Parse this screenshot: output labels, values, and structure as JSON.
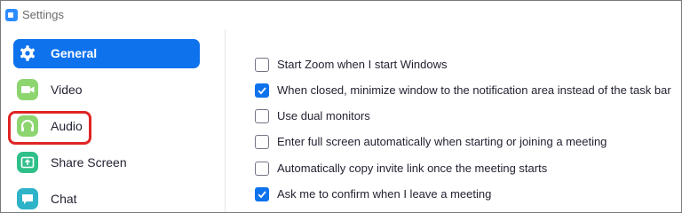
{
  "window": {
    "title": "Settings"
  },
  "colors": {
    "accent": "#0e72ed",
    "video_icon": "#8dd56f",
    "audio_icon": "#8dd56f",
    "share_icon": "#2fc08a",
    "chat_icon": "#2fb3c8",
    "highlight": "#e02424"
  },
  "sidebar": {
    "items": [
      {
        "label": "General",
        "icon": "gear-icon",
        "active": true
      },
      {
        "label": "Video",
        "icon": "video-camera-icon",
        "active": false
      },
      {
        "label": "Audio",
        "icon": "headphones-icon",
        "active": false,
        "highlighted": true
      },
      {
        "label": "Share Screen",
        "icon": "share-screen-icon",
        "active": false
      },
      {
        "label": "Chat",
        "icon": "chat-bubble-icon",
        "active": false
      }
    ]
  },
  "general": {
    "options": [
      {
        "label": "Start Zoom when I start Windows",
        "checked": false
      },
      {
        "label": "When closed, minimize window to the notification area instead of the task bar",
        "checked": true
      },
      {
        "label": "Use dual monitors",
        "checked": false
      },
      {
        "label": "Enter full screen automatically when starting or joining a meeting",
        "checked": false
      },
      {
        "label": "Automatically copy invite link once the meeting starts",
        "checked": false
      },
      {
        "label": "Ask me to confirm when I leave a meeting",
        "checked": true
      }
    ]
  }
}
